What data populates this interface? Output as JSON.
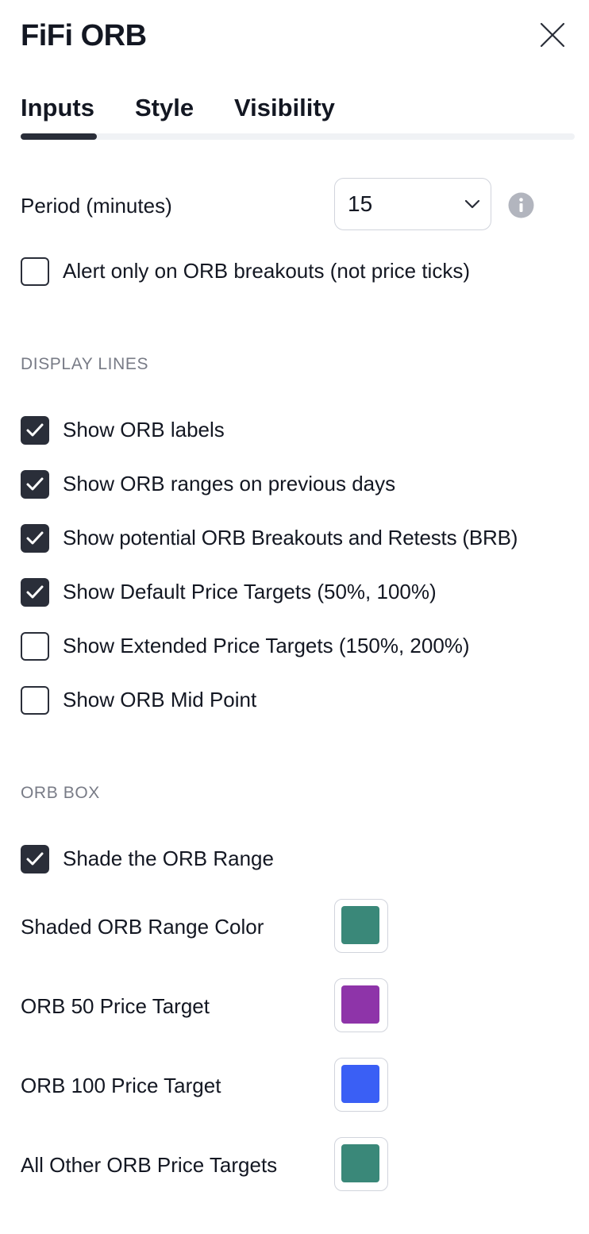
{
  "header": {
    "title": "FiFi ORB"
  },
  "tabs": [
    {
      "label": "Inputs",
      "active": true
    },
    {
      "label": "Style",
      "active": false
    },
    {
      "label": "Visibility",
      "active": false
    }
  ],
  "period": {
    "label": "Period (minutes)",
    "value": "15"
  },
  "alert_only": {
    "label": "Alert only on ORB breakouts (not price ticks)",
    "checked": false
  },
  "display_lines": {
    "heading": "DISPLAY LINES",
    "items": [
      {
        "label": "Show ORB labels",
        "checked": true
      },
      {
        "label": "Show ORB ranges on previous days",
        "checked": true
      },
      {
        "label": "Show potential ORB Breakouts and Retests (BRB)",
        "checked": true
      },
      {
        "label": "Show Default Price Targets (50%, 100%)",
        "checked": true
      },
      {
        "label": "Show Extended Price Targets (150%, 200%)",
        "checked": false
      },
      {
        "label": "Show ORB Mid Point",
        "checked": false
      }
    ]
  },
  "orb_box": {
    "heading": "ORB BOX",
    "shade": {
      "label": "Shade the ORB Range",
      "checked": true
    },
    "colors": [
      {
        "label": "Shaded ORB Range Color",
        "color": "#3a8879"
      },
      {
        "label": "ORB 50 Price Target",
        "color": "#8e34a9"
      },
      {
        "label": "ORB 100 Price Target",
        "color": "#3a5ff5"
      },
      {
        "label": "All Other ORB Price Targets",
        "color": "#3a8879"
      }
    ]
  }
}
